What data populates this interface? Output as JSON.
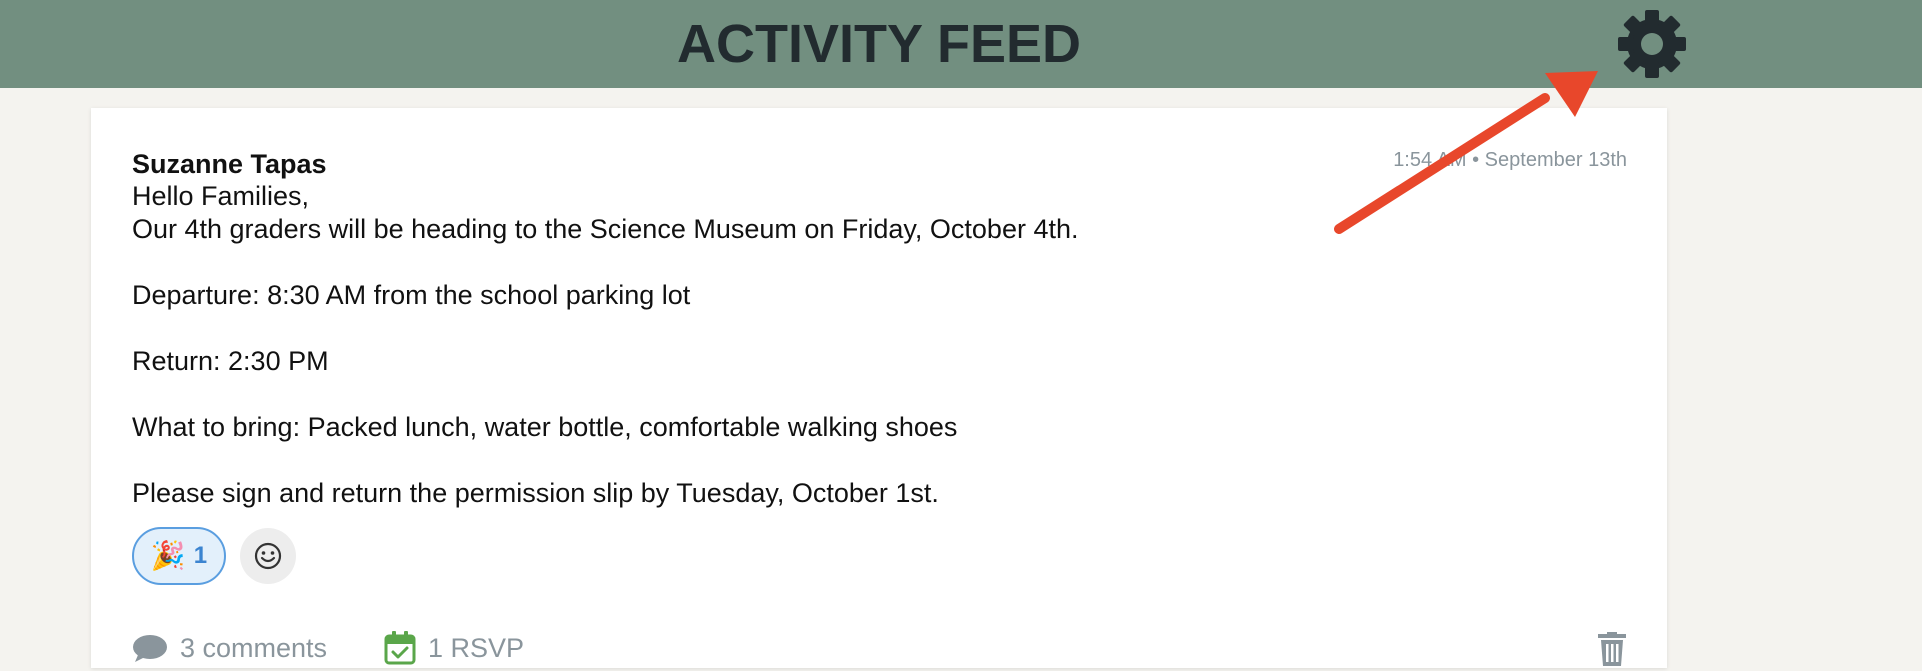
{
  "header": {
    "title": "ACTIVITY FEED",
    "settings_icon": "gear-icon"
  },
  "post": {
    "author": "Suzanne Tapas",
    "timestamp": "1:54 AM • September 13th",
    "lines": [
      "Hello Families,",
      "Our 4th graders will be heading to the Science Museum on Friday, October 4th.",
      "Departure: 8:30 AM from the school parking lot",
      "Return: 2:30 PM",
      "What to bring: Packed lunch, water bottle, comfortable walking shoes",
      "Please sign and return the permission slip by Tuesday, October 1st."
    ],
    "reaction": {
      "emoji": "🎉",
      "count": "1"
    },
    "add_reaction_icon": "smiley-icon",
    "comments_label": "3 comments",
    "rsvp_label": "1 RSVP",
    "delete_icon": "trash-icon"
  },
  "colors": {
    "header_bg": "#728f80",
    "title_text": "#222b2f",
    "page_bg": "#f4f3ef",
    "reaction_border": "#5a9ee0",
    "reaction_bg": "#e3f0fb",
    "muted_text": "#8a959c",
    "rsvp_green": "#5aa64a",
    "annotation_arrow": "#e8472b"
  }
}
